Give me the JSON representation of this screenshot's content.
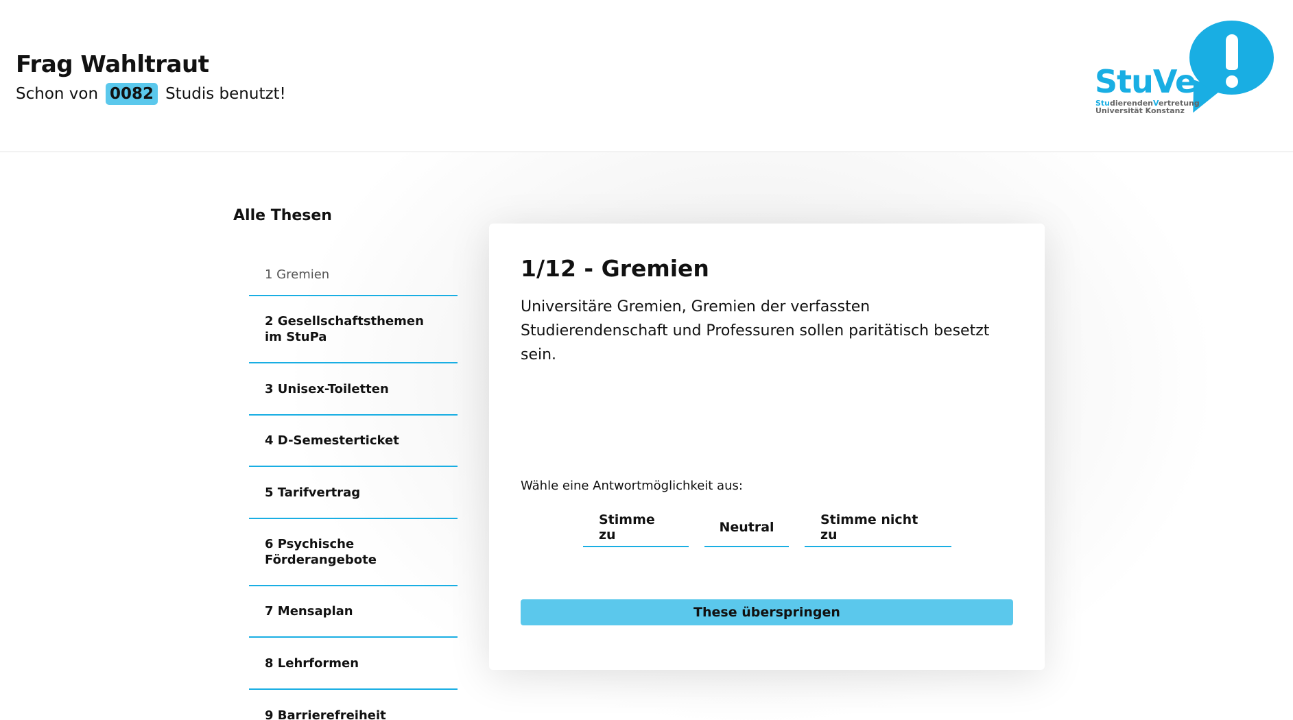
{
  "header": {
    "title": "Frag Wahltraut",
    "usage_prefix": "Schon von",
    "usage_count": "0082",
    "usage_suffix": "Studis benutzt!"
  },
  "logo": {
    "wordmark": "StuVe",
    "line1_hl1": "Stu",
    "line1_mid": "dierenden",
    "line1_hl2": "V",
    "line1_end": "ertretung",
    "line2": "Universität Konstanz",
    "color": "#19aee3"
  },
  "sidebar": {
    "title": "Alle Thesen",
    "items": [
      {
        "label": "1 Gremien"
      },
      {
        "label": "2 Gesellschaftsthemen im StuPa"
      },
      {
        "label": "3 Unisex-Toiletten"
      },
      {
        "label": "4 D-Semesterticket"
      },
      {
        "label": "5 Tarifvertrag"
      },
      {
        "label": "6 Psychische Förderangebote"
      },
      {
        "label": "7 Mensaplan"
      },
      {
        "label": "8 Lehrformen"
      },
      {
        "label": "9 Barrierefreiheit"
      }
    ]
  },
  "card": {
    "title": "1/12 - Gremien",
    "text": "Universitäre Gremien, Gremien der verfassten Studierendenschaft und Professuren sollen paritätisch besetzt sein.",
    "prompt": "Wähle eine Antwortmöglichkeit aus:",
    "answers": {
      "agree": "Stimme zu",
      "neutral": "Neutral",
      "disagree": "Stimme nicht zu"
    },
    "skip": "These überspringen"
  },
  "colors": {
    "accent": "#19aee3",
    "button": "#5bc8ec"
  }
}
